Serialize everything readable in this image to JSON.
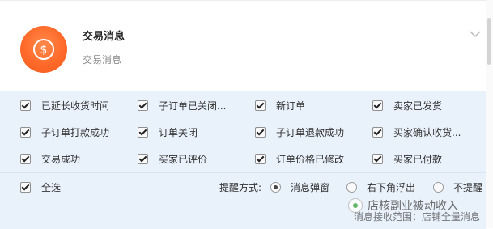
{
  "header": {
    "title": "交易消息",
    "subtitle": "交易消息",
    "icon": "coin-icon",
    "accent_color": "#ff6a2a"
  },
  "options": [
    {
      "label": "已延长收货时间",
      "checked": true
    },
    {
      "label": "子订单已关闭...",
      "checked": true
    },
    {
      "label": "新订单",
      "checked": true
    },
    {
      "label": "卖家已发货",
      "checked": true
    },
    {
      "label": "子订单打款成功",
      "checked": true
    },
    {
      "label": "订单关闭",
      "checked": true
    },
    {
      "label": "子订单退款成功",
      "checked": true
    },
    {
      "label": "买家确认收货...",
      "checked": true
    },
    {
      "label": "交易成功",
      "checked": true
    },
    {
      "label": "买家已评价",
      "checked": true
    },
    {
      "label": "订单价格已修改",
      "checked": true
    },
    {
      "label": "买家已付款",
      "checked": true
    }
  ],
  "footer": {
    "select_all_label": "全选",
    "select_all_checked": true,
    "remind_label": "提醒方式:",
    "remind_options": [
      {
        "label": "消息弹窗",
        "selected": true
      },
      {
        "label": "右下角浮出",
        "selected": false
      },
      {
        "label": "不提醒",
        "selected": false
      }
    ]
  },
  "watermark": {
    "line1": "店核副业被动收入",
    "line2": "消息接收范围：店铺全量消息"
  },
  "colors": {
    "panel_bg": "#e9f1fb",
    "border": "#d6e3f2"
  }
}
